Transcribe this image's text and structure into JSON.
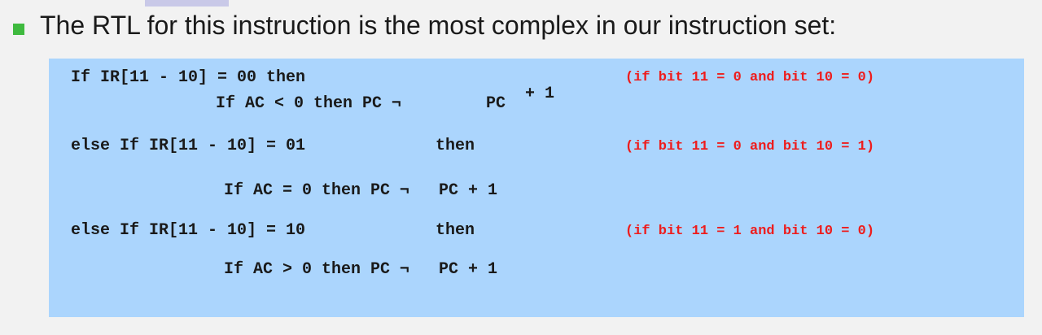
{
  "slide": {
    "heading": "The RTL for this instruction is the most complex in our instruction set:"
  },
  "rtl": {
    "line1": "If IR[11 - 10] = 00 then",
    "line1_comment": "(if bit 11 = 0 and bit 10 = 0)",
    "line2_cond": "If AC < 0 then PC ¬",
    "line2_pc": "PC",
    "line2_plus": "+ 1",
    "line3": "else If IR[11 - 10] = 01",
    "line3_then": "then",
    "line3_comment": "(if bit 11 = 0 and bit 10 = 1)",
    "line4": "If AC = 0 then PC ¬   PC + 1",
    "line5": "else If IR[11 - 10] = 10",
    "line5_then": "then",
    "line5_comment": "(if bit 11 = 1 and bit 10 = 0)",
    "line6": "If AC > 0 then PC ¬   PC + 1"
  }
}
